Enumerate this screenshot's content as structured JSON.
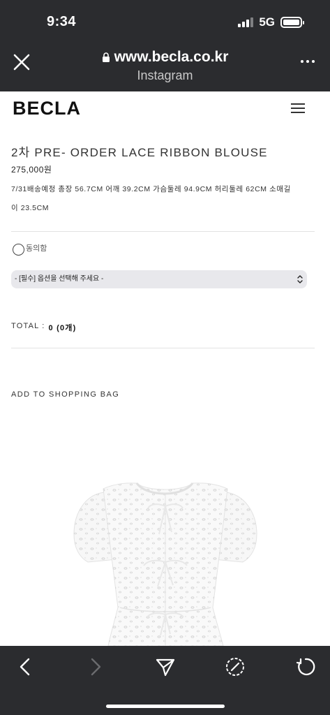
{
  "status_bar": {
    "time": "9:34",
    "network": "5G"
  },
  "browser": {
    "url": "www.becla.co.kr",
    "subtitle": "Instagram"
  },
  "site": {
    "logo": "BECLA"
  },
  "product": {
    "title": "2차 PRE- ORDER LACE RIBBON BLOUSE",
    "price": "275,000원",
    "description_line1": "7/31배송예정 총장 56.7CM 어깨 39.2CM 가슴둘레 94.9CM 허리둘레 62CM 소매길",
    "description_line2": "이 23.5CM"
  },
  "options": {
    "agree_label": "동의함",
    "select_value": "- [필수] 옵션을 선택해 주세요 -"
  },
  "total": {
    "label": "TOTAL :",
    "value": "0 (0개)"
  },
  "actions": {
    "add_to_bag": "ADD TO SHOPPING BAG"
  },
  "icons": {
    "close": "close-icon",
    "lock": "lock-icon",
    "more": "more-icon",
    "menu": "menu-icon",
    "back": "chevron-left-icon",
    "forward": "chevron-right-icon",
    "share": "send-icon",
    "safari": "compass-icon",
    "reload": "reload-icon"
  },
  "colors": {
    "chrome_bg": "#2b2c2f",
    "select_bg": "#e8e8ec"
  }
}
